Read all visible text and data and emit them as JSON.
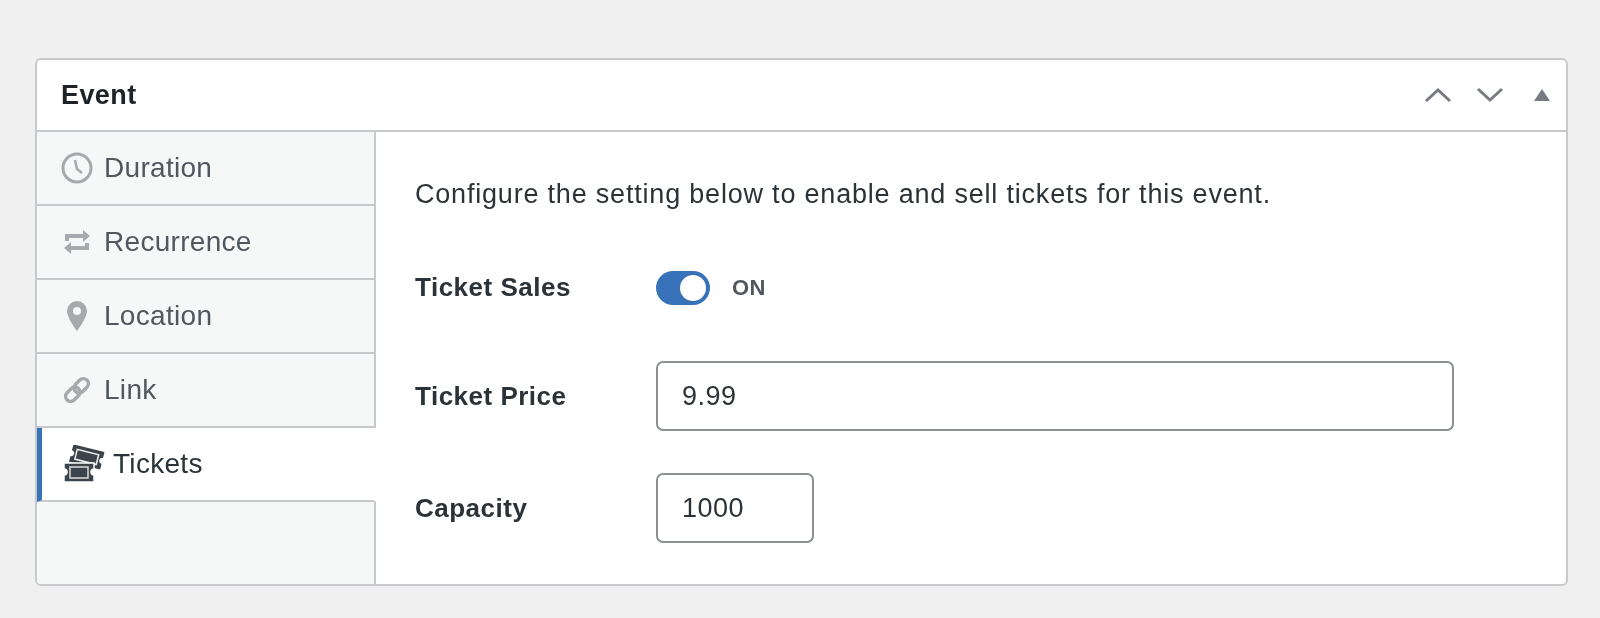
{
  "panel": {
    "title": "Event"
  },
  "sidebar": {
    "tabs": [
      {
        "label": "Duration",
        "kind": "clock",
        "selected": false
      },
      {
        "label": "Recurrence",
        "kind": "repeat",
        "selected": false
      },
      {
        "label": "Location",
        "kind": "pin",
        "selected": false
      },
      {
        "label": "Link",
        "kind": "chain",
        "selected": false
      },
      {
        "label": "Tickets",
        "kind": "tickets",
        "selected": true
      }
    ]
  },
  "content": {
    "description": "Configure the setting below to enable and sell tickets for this event.",
    "fields": [
      {
        "kind": "toggle",
        "label": "Ticket Sales",
        "on": true,
        "state_text": "ON"
      },
      {
        "kind": "text",
        "label": "Ticket Price",
        "value": "9.99"
      },
      {
        "kind": "number",
        "label": "Capacity",
        "value": "1000"
      }
    ]
  }
}
